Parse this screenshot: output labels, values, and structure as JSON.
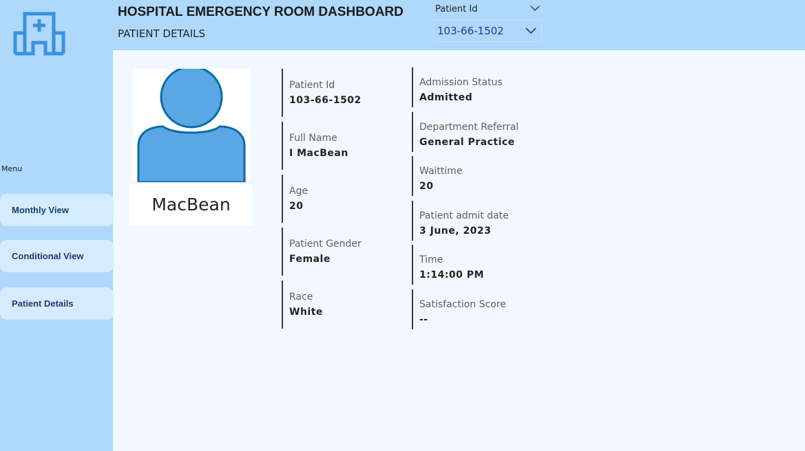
{
  "header": {
    "title": "HOSPITAL EMERGENCY ROOM DASHBOARD",
    "subtitle": "PATIENT DETAILS",
    "logo_icon": "hospital-icon"
  },
  "slicer": {
    "label": "Patient Id",
    "selected": "103-66-1502"
  },
  "sidebar": {
    "menu_label": "Menu",
    "items": [
      {
        "label": "Monthly View"
      },
      {
        "label": "Conditional View"
      },
      {
        "label": "Patient Details"
      }
    ]
  },
  "patient": {
    "display_name": "MacBean",
    "left_fields": [
      {
        "label": "Patient Id",
        "value": "103-66-1502"
      },
      {
        "label": "Full Name",
        "value": "I MacBean"
      },
      {
        "label": "Age",
        "value": "20"
      },
      {
        "label": "Patient Gender",
        "value": "Female"
      },
      {
        "label": "Race",
        "value": "White"
      }
    ],
    "right_fields": [
      {
        "label": "Admission Status",
        "value": "Admitted"
      },
      {
        "label": "Department Referral",
        "value": "General Practice"
      },
      {
        "label": "Waittime",
        "value": "20"
      },
      {
        "label": "Patient admit date",
        "value": "3 June, 2023"
      },
      {
        "label": "Time",
        "value": "1:14:00 PM"
      },
      {
        "label": "Satisfaction Score",
        "value": "--"
      }
    ]
  },
  "colors": {
    "sidebar_bg": "#aed8fc",
    "main_bg": "#f1f8ff",
    "accent": "#3a91e0",
    "avatar_fill": "#5aa7e6",
    "avatar_stroke": "#0a6aa8"
  }
}
